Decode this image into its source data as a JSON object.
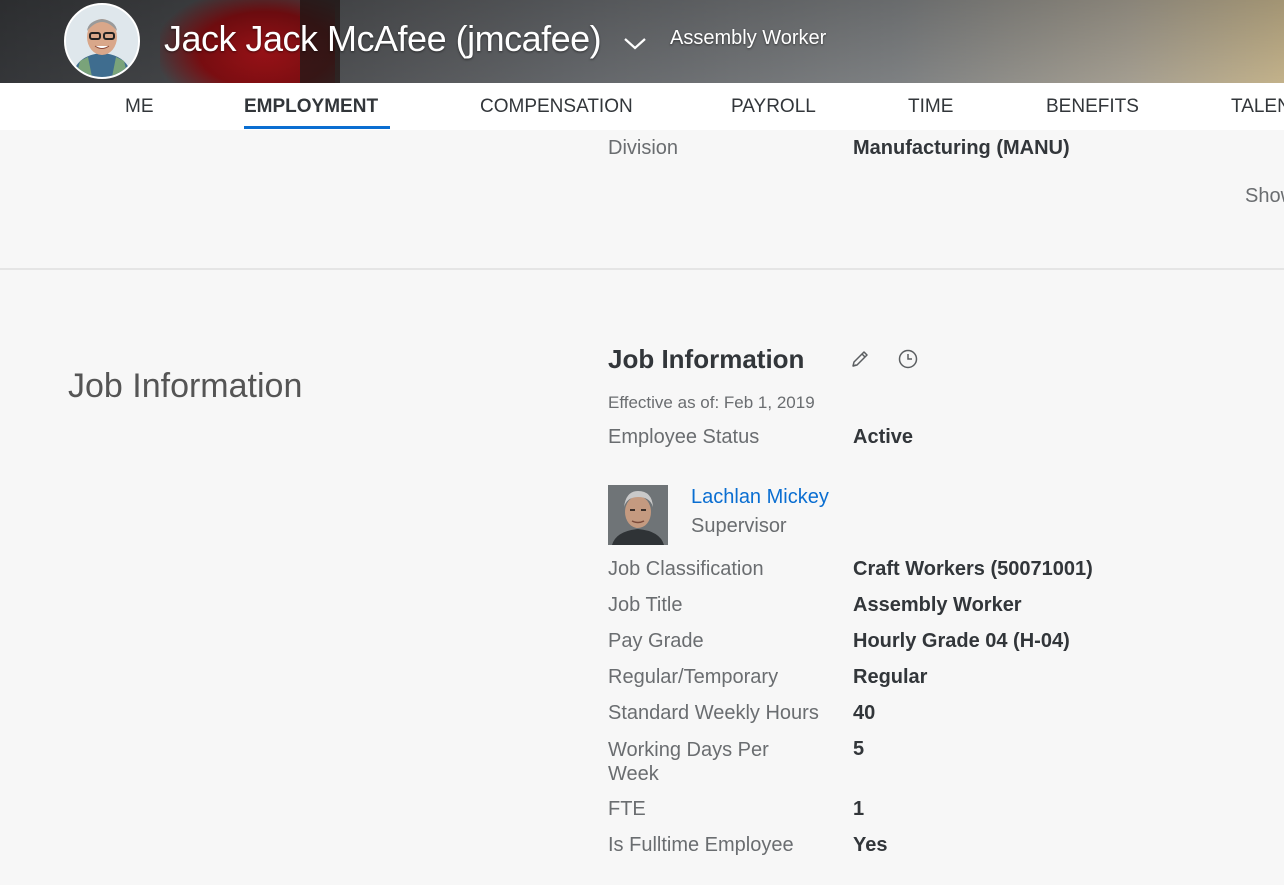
{
  "header": {
    "employee_name": "Jack Jack McAfee (jmcafee)",
    "job_title": "Assembly Worker"
  },
  "tabs": [
    {
      "label": "ME"
    },
    {
      "label": "EMPLOYMENT",
      "active": true
    },
    {
      "label": "COMPENSATION"
    },
    {
      "label": "PAYROLL"
    },
    {
      "label": "TIME"
    },
    {
      "label": "BENEFITS"
    },
    {
      "label": "TALEN"
    }
  ],
  "org_info": {
    "division_label": "Division",
    "division_value": "Manufacturing (MANU)",
    "show_more": "Show"
  },
  "job_section": {
    "section_title": "Job Information",
    "card_title": "Job Information",
    "effective": "Effective as of: Feb 1, 2019",
    "employee_status_label": "Employee Status",
    "employee_status_value": "Active",
    "supervisor": {
      "name": "Lachlan Mickey",
      "role": "Supervisor"
    },
    "fields": [
      {
        "label": "Job Classification",
        "value": "Craft Workers (50071001)"
      },
      {
        "label": "Job Title",
        "value": "Assembly Worker"
      },
      {
        "label": "Pay Grade",
        "value": "Hourly Grade 04 (H-04)"
      },
      {
        "label": "Regular/Temporary",
        "value": "Regular"
      },
      {
        "label": "Standard Weekly Hours",
        "value": "40"
      },
      {
        "label": "Working Days Per Week",
        "value": "5"
      },
      {
        "label": "FTE",
        "value": "1"
      },
      {
        "label": "Is Fulltime Employee",
        "value": "Yes"
      }
    ]
  },
  "colors": {
    "accent": "#0a6ed1",
    "text": "#32363a",
    "muted": "#6a6d70"
  },
  "icons": [
    "chevron-down-icon",
    "pencil-icon",
    "history-clock-icon"
  ]
}
